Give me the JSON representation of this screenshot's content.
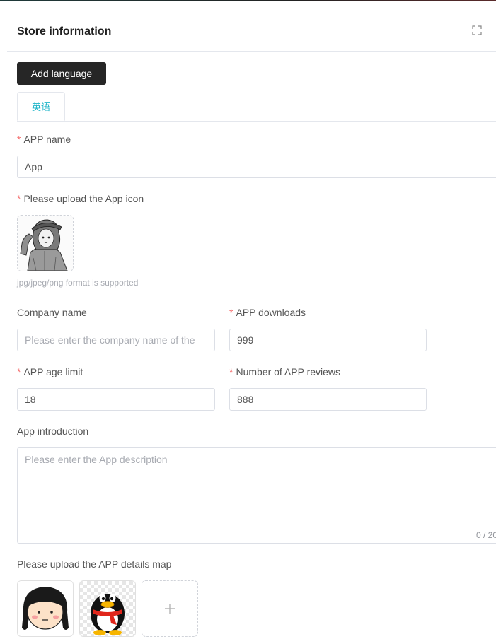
{
  "panel": {
    "title": "Store information",
    "fullscreen_icon": "fullscreen-icon"
  },
  "toolbar": {
    "add_language_label": "Add language"
  },
  "tabs": [
    {
      "label": "英语",
      "active": true
    }
  ],
  "form": {
    "app_name": {
      "label": "APP name",
      "required": "*",
      "value": "App"
    },
    "app_icon": {
      "label": "Please upload the App icon",
      "required": "*",
      "hint": "jpg/jpeg/png format is supported",
      "image": "sketch-girl-avatar"
    },
    "company_name": {
      "label": "Company name",
      "placeholder": "Please enter the company name of the"
    },
    "app_downloads": {
      "label": "APP downloads",
      "required": "*",
      "value": "999"
    },
    "app_age_limit": {
      "label": "APP age limit",
      "required": "*",
      "value": "18"
    },
    "app_reviews": {
      "label": "Number of APP reviews",
      "required": "*",
      "value": "888"
    },
    "app_introduction": {
      "label": "App introduction",
      "placeholder": "Please enter the App description",
      "counter": "0 / 20"
    },
    "details_map": {
      "label": "Please upload the APP details map",
      "images": [
        "cartoon-girl-face",
        "qq-penguin"
      ],
      "add_icon": "plus-icon"
    }
  },
  "colors": {
    "accent": "#1fb5c8",
    "required": "#f56c6c",
    "button_bg": "#262626",
    "border": "#dcdfe6"
  }
}
